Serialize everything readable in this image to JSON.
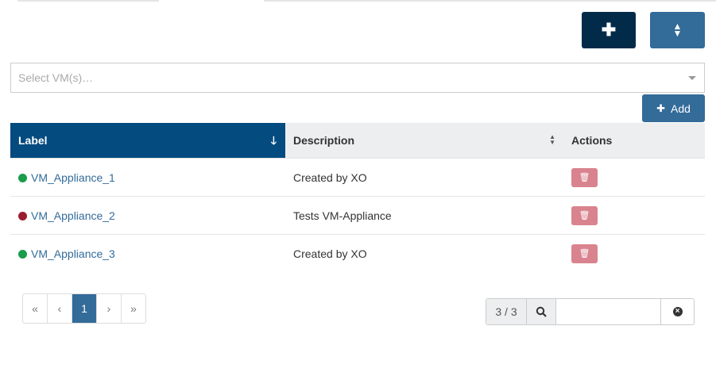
{
  "toolbar": {
    "add_icon": "plus-icon",
    "sort_icon": "sort-icon",
    "primary_color": "#022b4a",
    "secondary_color": "#336b99"
  },
  "select": {
    "placeholder": "Select VM(s)…"
  },
  "add_button": {
    "label": "Add"
  },
  "table": {
    "columns": [
      {
        "label": "Label",
        "sort": "descending"
      },
      {
        "label": "Description",
        "sort": "none"
      },
      {
        "label": "Actions"
      }
    ],
    "rows": [
      {
        "label": "VM_Appliance_1",
        "status": "running",
        "status_color": "#1a9c4b",
        "description": "Created by XO"
      },
      {
        "label": "VM_Appliance_2",
        "status": "halted",
        "status_color": "#9b1c31",
        "description": "Tests VM-Appliance"
      },
      {
        "label": "VM_Appliance_3",
        "status": "running",
        "status_color": "#1a9c4b",
        "description": "Created by XO"
      }
    ]
  },
  "pagination": {
    "first": "«",
    "prev": "‹",
    "current": "1",
    "next": "›",
    "last": "»"
  },
  "filter": {
    "count": "3 / 3",
    "value": ""
  }
}
